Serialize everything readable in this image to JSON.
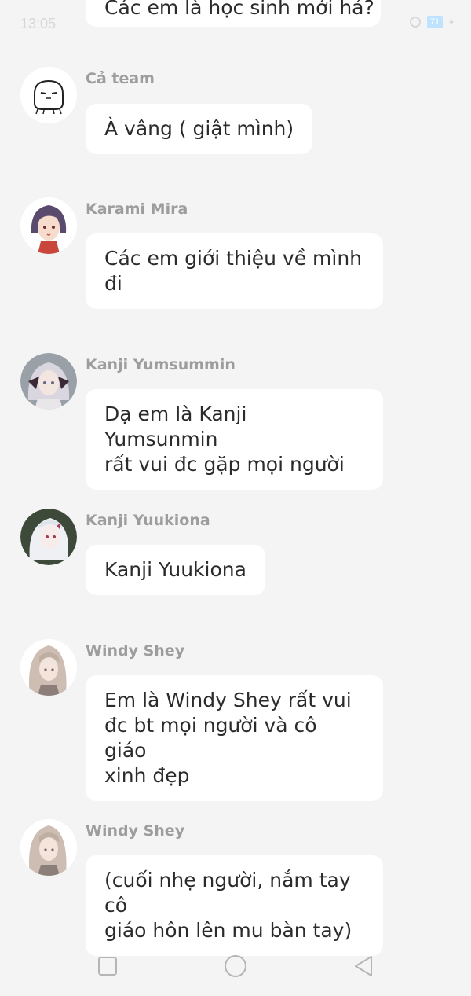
{
  "status_bar": {
    "time": "13:05",
    "battery": "71"
  },
  "partial_message": {
    "text": "Các em là học sinh mới hả?"
  },
  "messages": [
    {
      "sender": "Cả team",
      "text": "À vâng ( giật mình)",
      "avatar": "mascot-avatar"
    },
    {
      "sender": "Karami Mira",
      "text": "Các em giới thiệu về mình\nđi",
      "avatar": "anime-girl-purple-hair-avatar"
    },
    {
      "sender": "Kanji Yumsummin",
      "text": "Dạ em là Kanji Yumsunmin\nrất vui đc gặp mọi người",
      "avatar": "anime-girl-silver-hair-avatar"
    },
    {
      "sender": "Kanji Yuukiona",
      "text": "Kanji Yuukiona",
      "avatar": "anime-girl-white-hair-avatar"
    },
    {
      "sender": "Windy Shey",
      "text": "Em là Windy Shey rất vui\nđc bt mọi người và cô giáo\nxinh đẹp",
      "avatar": "anime-girl-beige-hair-avatar"
    },
    {
      "sender": "Windy Shey",
      "text": "(cuối nhẹ người, nắm tay cô\ngiáo hôn lên mu bàn tay)",
      "avatar": "anime-girl-beige-hair-avatar"
    }
  ],
  "nav_bar": {
    "buttons": [
      "recent-apps",
      "home",
      "back"
    ]
  }
}
